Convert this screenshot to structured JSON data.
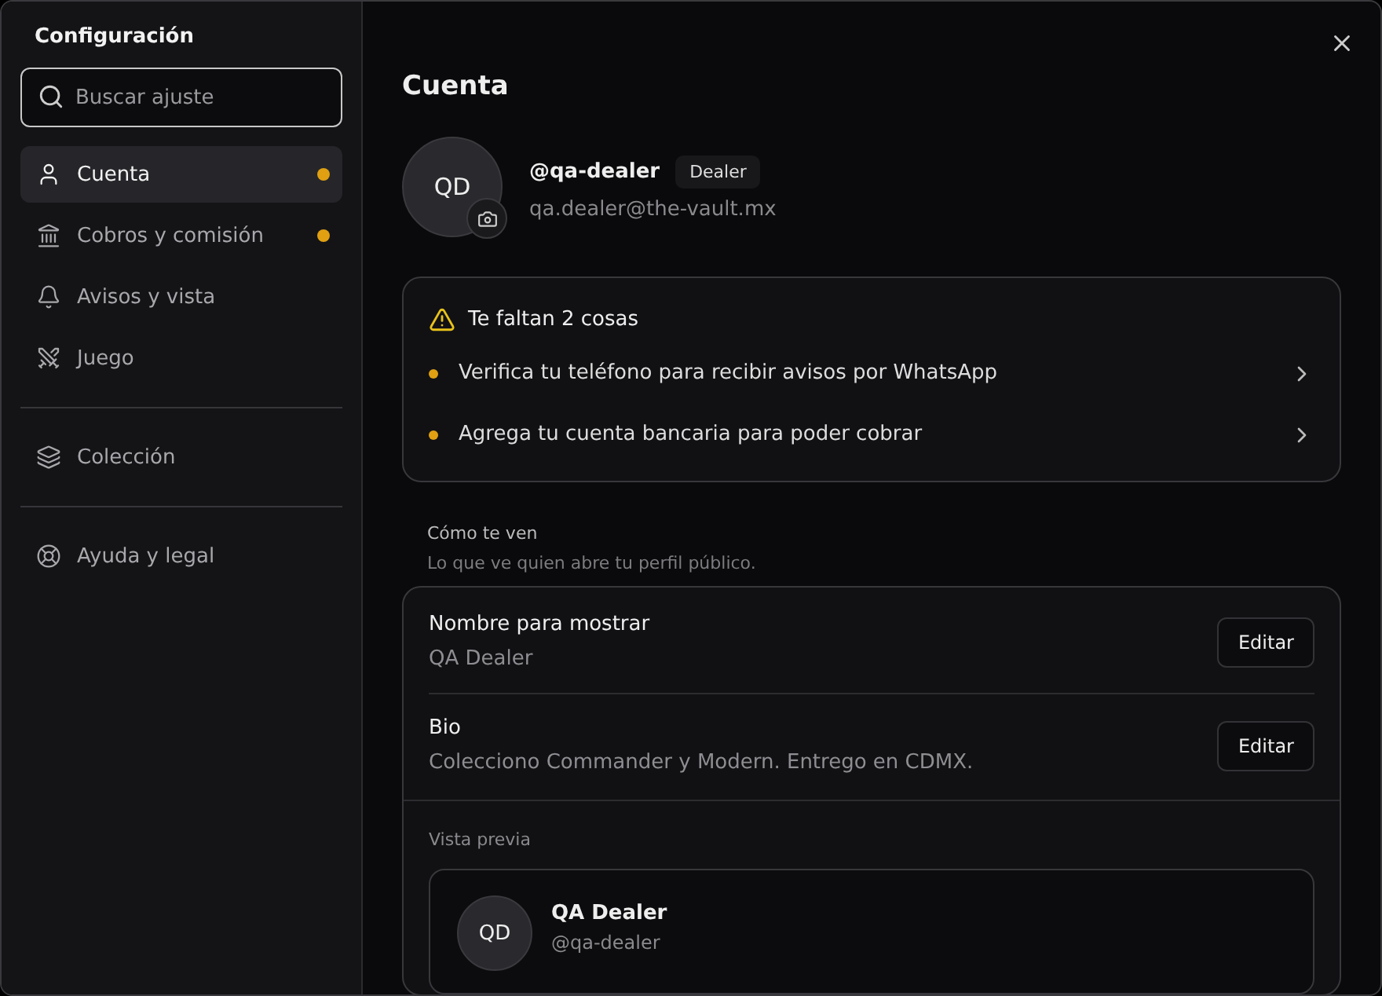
{
  "sidebar": {
    "title": "Configuración",
    "search": {
      "placeholder": "Buscar ajuste"
    },
    "groups": [
      [
        {
          "kind": "user",
          "label": "Cuenta",
          "selected": true,
          "alert": true
        },
        {
          "kind": "bank",
          "label": "Cobros y comisión",
          "selected": false,
          "alert": true
        },
        {
          "kind": "bell",
          "label": "Avisos y vista",
          "selected": false,
          "alert": false
        },
        {
          "kind": "swords",
          "label": "Juego",
          "selected": false,
          "alert": false
        }
      ],
      [
        {
          "kind": "layers",
          "label": "Colección",
          "selected": false,
          "alert": false
        }
      ],
      [
        {
          "kind": "lifebuoy",
          "label": "Ayuda y legal",
          "selected": false,
          "alert": false
        }
      ]
    ]
  },
  "main": {
    "title": "Cuenta",
    "profile": {
      "initials": "QD",
      "handle": "@qa-dealer",
      "badge": "Dealer",
      "email": "qa.dealer@the-vault.mx"
    },
    "todo": {
      "title": "Te faltan 2 cosas",
      "items": [
        "Verifica tu teléfono para recibir avisos por WhatsApp",
        "Agrega tu cuenta bancaria para poder cobrar"
      ]
    },
    "public": {
      "title": "Cómo te ven",
      "subtitle": "Lo que ve quien abre tu perfil público.",
      "fields": [
        {
          "label": "Nombre para mostrar",
          "value": "QA Dealer",
          "button": "Editar"
        },
        {
          "label": "Bio",
          "value": "Colecciono Commander y Modern. Entrego en CDMX.",
          "button": "Editar"
        }
      ],
      "preview": {
        "label": "Vista previa",
        "initials": "QD",
        "name": "QA Dealer",
        "handle": "@qa-dealer"
      }
    }
  }
}
